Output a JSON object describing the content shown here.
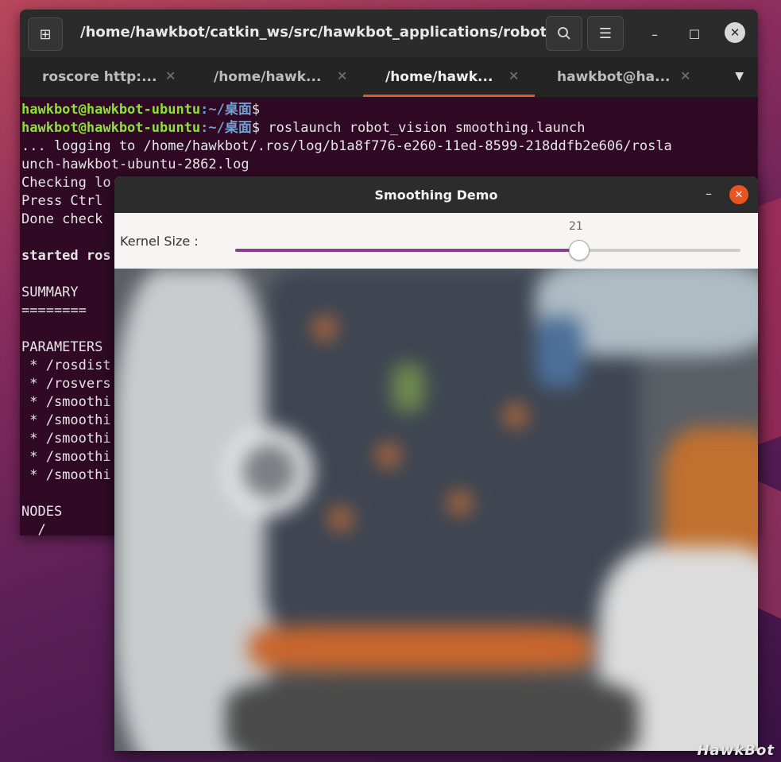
{
  "terminal": {
    "title": "/home/hawkbot/catkin_ws/src/hawkbot_applications/robot_...",
    "tabs": [
      {
        "label": "roscore http:...",
        "active": false
      },
      {
        "label": "/home/hawk...",
        "active": false
      },
      {
        "label": "/home/hawk...",
        "active": true
      },
      {
        "label": "hawkbot@ha...",
        "active": false
      }
    ],
    "lines": {
      "l1_user": "hawkbot@hawkbot-ubuntu",
      "l1_path": ":~/桌面",
      "l1_tail": "$",
      "l2_user": "hawkbot@hawkbot-ubuntu",
      "l2_path": ":~/桌面",
      "l2_tail": "$ roslaunch robot_vision smoothing.launch",
      "l3": "... logging to /home/hawkbot/.ros/log/b1a8f776-e260-11ed-8599-218ddfb2e606/rosla",
      "l4": "unch-hawkbot-ubuntu-2862.log",
      "l5": "Checking lo",
      "l6": "Press Ctrl",
      "l7": "Done check",
      "l8": "",
      "l9": "started ros",
      "l10": "",
      "l11": "SUMMARY",
      "l12": "========",
      "l13": "",
      "l14": "PARAMETERS",
      "l15": " * /rosdist",
      "l16": " * /rosvers",
      "l17": " * /smoothi",
      "l18": " * /smoothi",
      "l19": " * /smoothi",
      "l20": " * /smoothi",
      "l21": " * /smoothi",
      "l22": "",
      "l23": "NODES",
      "l24": "  /"
    }
  },
  "demo": {
    "title": "Smoothing Demo",
    "kernel_label": "Kernel Size :",
    "kernel_value": "21",
    "slider_fraction": 0.68
  },
  "watermark": "HawkBot",
  "colors": {
    "accent": "#e95420",
    "slider": "#8a3f8c",
    "prompt_user": "#8ae234",
    "prompt_path": "#729fcf"
  }
}
